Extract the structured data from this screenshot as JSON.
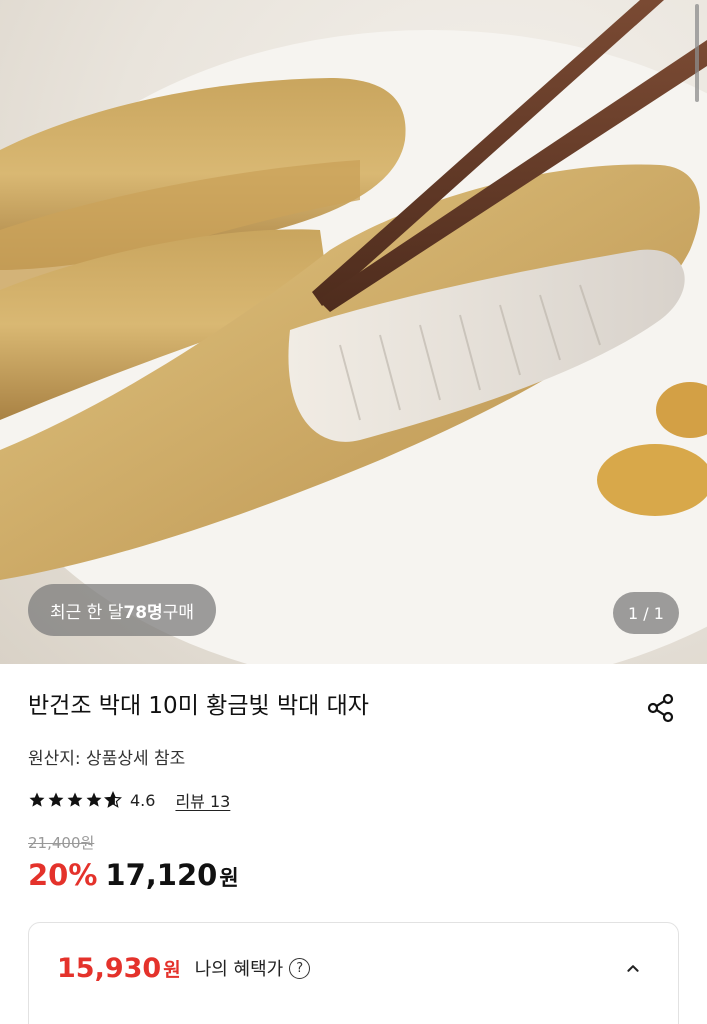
{
  "hero": {
    "image_alt": "grilled dried fish with chopsticks",
    "purchase_prefix": "최근 한 달 ",
    "purchase_count": "78명",
    "purchase_suffix": " 구매",
    "pager": "1 / 1"
  },
  "product": {
    "title": "반건조 박대 10미 황금빛 박대 대자",
    "origin": "원산지: 상품상세 참조",
    "rating": "4.6",
    "rating_stars": 4.6,
    "review_label": "리뷰 13",
    "original_price": "21,400원",
    "discount": "20%",
    "price": "17,120",
    "price_unit": "원"
  },
  "benefit": {
    "price": "15,930",
    "unit": "원",
    "label": "나의 혜택가",
    "help_icon": "?"
  },
  "icons": {
    "share": "share-icon",
    "star": "star-icon",
    "help": "question-circle-icon",
    "chevron": "chevron-up-icon"
  },
  "colors": {
    "accent_red": "#e4322b",
    "text": "#111111",
    "muted": "#999999"
  }
}
